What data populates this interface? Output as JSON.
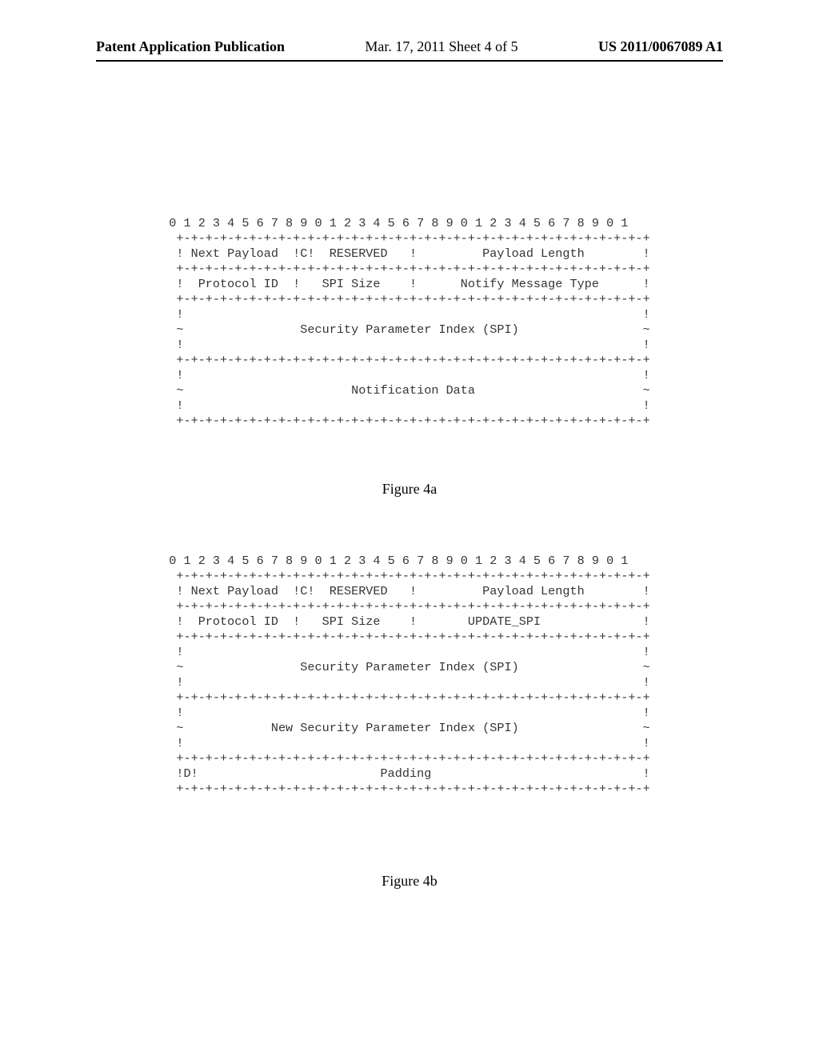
{
  "header": {
    "left": "Patent Application Publication",
    "center": "Mar. 17, 2011  Sheet 4 of 5",
    "right": "US 2011/0067089 A1"
  },
  "figure_a": {
    "caption": "Figure 4a",
    "ruler": "0 1 2 3 4 5 6 7 8 9 0 1 2 3 4 5 6 7 8 9 0 1 2 3 4 5 6 7 8 9 0 1",
    "sep": " +-+-+-+-+-+-+-+-+-+-+-+-+-+-+-+-+-+-+-+-+-+-+-+-+-+-+-+-+-+-+-+-+",
    "row1": " ! Next Payload  !C!  RESERVED   !         Payload Length        !",
    "row2": " !  Protocol ID  !   SPI Size    !      Notify Message Type      !",
    "spi1": " !                                                               !",
    "spi2": " ~                Security Parameter Index (SPI)                 ~",
    "spi3": " !                                                               !",
    "nd1": " !                                                               !",
    "nd2": " ~                       Notification Data                       ~",
    "nd3": " !                                                               !"
  },
  "figure_b": {
    "caption": "Figure 4b",
    "ruler": "0 1 2 3 4 5 6 7 8 9 0 1 2 3 4 5 6 7 8 9 0 1 2 3 4 5 6 7 8 9 0 1",
    "sep": " +-+-+-+-+-+-+-+-+-+-+-+-+-+-+-+-+-+-+-+-+-+-+-+-+-+-+-+-+-+-+-+-+",
    "row1": " ! Next Payload  !C!  RESERVED   !         Payload Length        !",
    "row2": " !  Protocol ID  !   SPI Size    !       UPDATE_SPI              !",
    "spi1": " !                                                               !",
    "spi2": " ~                Security Parameter Index (SPI)                 ~",
    "spi3": " !                                                               !",
    "nspi1": " !                                                               !",
    "nspi2": " ~            New Security Parameter Index (SPI)                 ~",
    "nspi3": " !                                                               !",
    "pad": " !D!                         Padding                             !"
  }
}
